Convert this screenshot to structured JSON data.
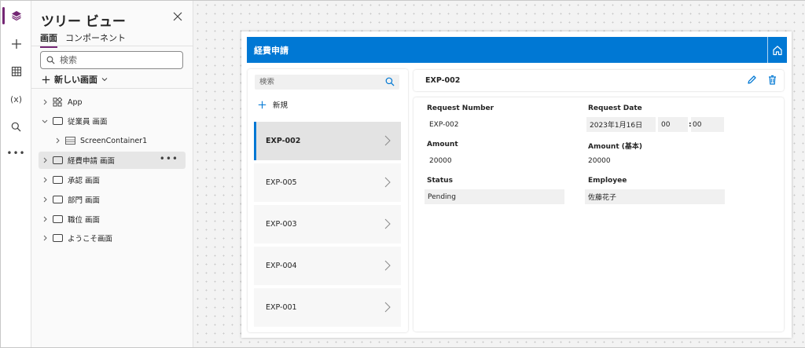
{
  "tree_panel": {
    "title": "ツリー ビュー",
    "tabs": [
      {
        "label": "画面",
        "active": true
      },
      {
        "label": "コンポーネント",
        "active": false
      }
    ],
    "search_placeholder": "検索",
    "new_screen_label": "新しい画面",
    "nodes": [
      {
        "label": "App",
        "icon": "app-grid-icon",
        "selected": false
      },
      {
        "label": "従業員 画面",
        "icon": "screen-icon",
        "selected": false,
        "expanded": true
      },
      {
        "label": "ScreenContainer1",
        "icon": "container-icon",
        "selected": false
      },
      {
        "label": "経費申請 画面",
        "icon": "screen-icon",
        "selected": true
      },
      {
        "label": "承認 画面",
        "icon": "screen-icon",
        "selected": false
      },
      {
        "label": "部門 画面",
        "icon": "screen-icon",
        "selected": false
      },
      {
        "label": "職位 画面",
        "icon": "screen-icon",
        "selected": false
      },
      {
        "label": "ようこそ画面",
        "icon": "screen-icon",
        "selected": false
      }
    ]
  },
  "app": {
    "header_title": "経費申請",
    "gallery": {
      "search_placeholder": "検索",
      "new_label": "新規",
      "items": [
        "EXP-002",
        "EXP-005",
        "EXP-003",
        "EXP-004",
        "EXP-001"
      ],
      "selected": "EXP-002"
    },
    "detail": {
      "title": "EXP-002",
      "request_number_label": "Request Number",
      "request_number": "EXP-002",
      "request_date_label": "Request Date",
      "request_date": "2023年1月16日",
      "hour": "00",
      "time_sep": ":",
      "minute": "00",
      "amount_label": "Amount",
      "amount": "20000",
      "amount_base_label": "Amount (基本)",
      "amount_base": "20000",
      "status_label": "Status",
      "status": "Pending",
      "employee_label": "Employee",
      "employee": "佐藤花子"
    }
  },
  "colors": {
    "accent": "#742774",
    "header": "#0078d4"
  }
}
